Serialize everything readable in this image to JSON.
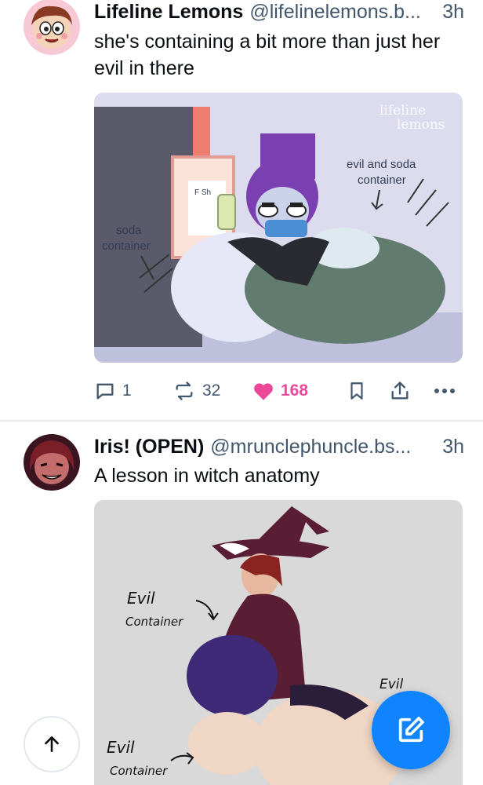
{
  "feed": {
    "posts": [
      {
        "author_name": "Lifeline Lemons",
        "author_handle": "@lifelinelemons.b...",
        "time": "3h",
        "text": "she's containing a bit more than just her evil in there",
        "image": {
          "watermark_line1": "lifeline",
          "watermark_line2": "lemons",
          "label_left_line1": "soda",
          "label_left_line2": "container",
          "label_right_line1": "evil and soda",
          "label_right_line2": "container",
          "fridge_text": "F Sh"
        },
        "stats": {
          "replies": "1",
          "reposts": "32",
          "likes": "168"
        }
      },
      {
        "author_name": "Iris! (OPEN)",
        "author_handle": "@mrunclephuncle.bs...",
        "time": "3h",
        "text": "A lesson in witch anatomy",
        "image": {
          "label_top_line1": "Evil",
          "label_top_line2": "Container",
          "label_bottom_line1": "Evil",
          "label_bottom_line2": "Container",
          "label_right": "Evil"
        }
      }
    ]
  },
  "colors": {
    "accent": "#1083fe",
    "like": "#ec4899",
    "muted": "#42576c"
  },
  "icons": [
    "reply-icon",
    "repost-icon",
    "heart-icon",
    "bookmark-icon",
    "share-icon",
    "more-icon",
    "compose-icon",
    "arrow-up-icon"
  ]
}
